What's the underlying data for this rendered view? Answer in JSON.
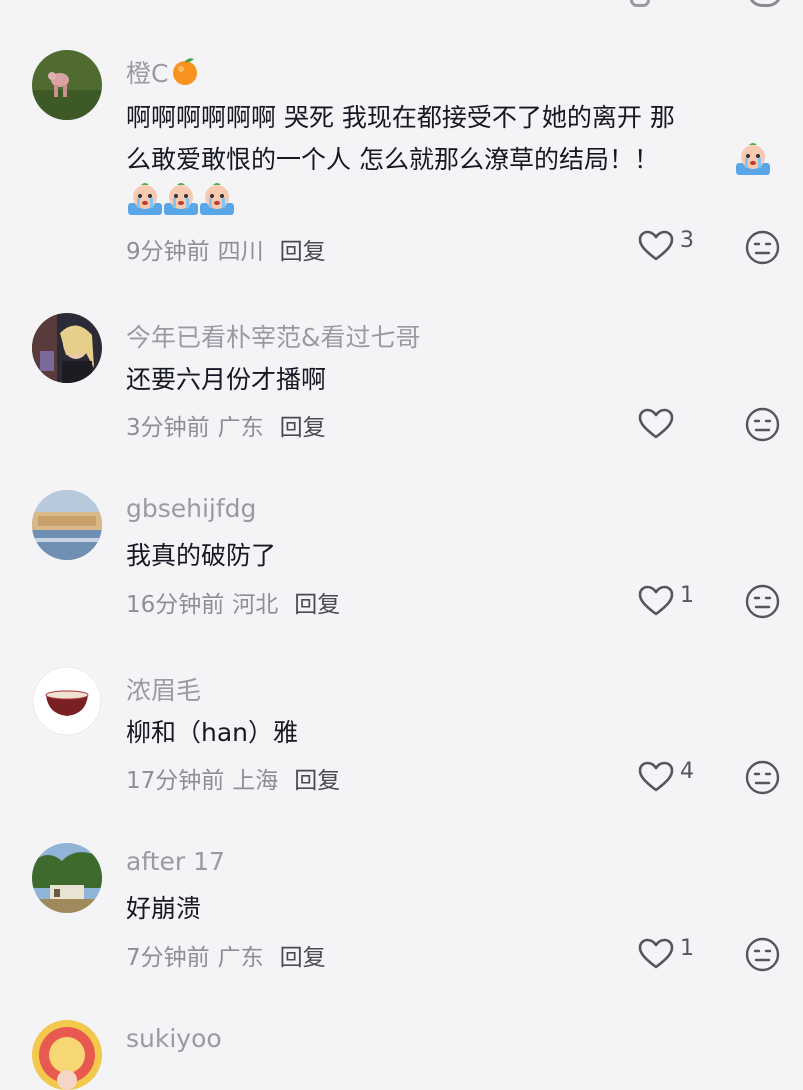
{
  "comments": [
    {
      "username": "橙C",
      "username_emoji": "orange-emoji",
      "text_line1": "啊啊啊啊啊啊 哭死   我现在都接受不了她的离开    那",
      "text_line2": "么敢爱敢恨的一个人  怎么就那么潦草的结局！！",
      "time": "9分钟前",
      "location": "四川",
      "reply": "回复",
      "likes": "3"
    },
    {
      "username": "今年已看朴宰范&看过七哥",
      "text_line1": "还要六月份才播啊",
      "time": "3分钟前",
      "location": "广东",
      "reply": "回复",
      "likes": ""
    },
    {
      "username": "gbsehijfdg",
      "text_line1": "我真的破防了",
      "time": "16分钟前",
      "location": "河北",
      "reply": "回复",
      "likes": "1"
    },
    {
      "username": "浓眉毛",
      "text_line1": "柳和（han）雅",
      "time": "17分钟前",
      "location": "上海",
      "reply": "回复",
      "likes": "4"
    },
    {
      "username": "after 17",
      "text_line1": "好崩溃",
      "time": "7分钟前",
      "location": "广东",
      "reply": "回复",
      "likes": "1"
    },
    {
      "username": "sukiyoo",
      "text_line1": "",
      "time": "",
      "location": "",
      "reply": "",
      "likes": ""
    }
  ],
  "colors": {
    "background": "#f4f4f6",
    "username": "#9a9aa4",
    "text": "#161823",
    "meta": "#8e8e96"
  }
}
